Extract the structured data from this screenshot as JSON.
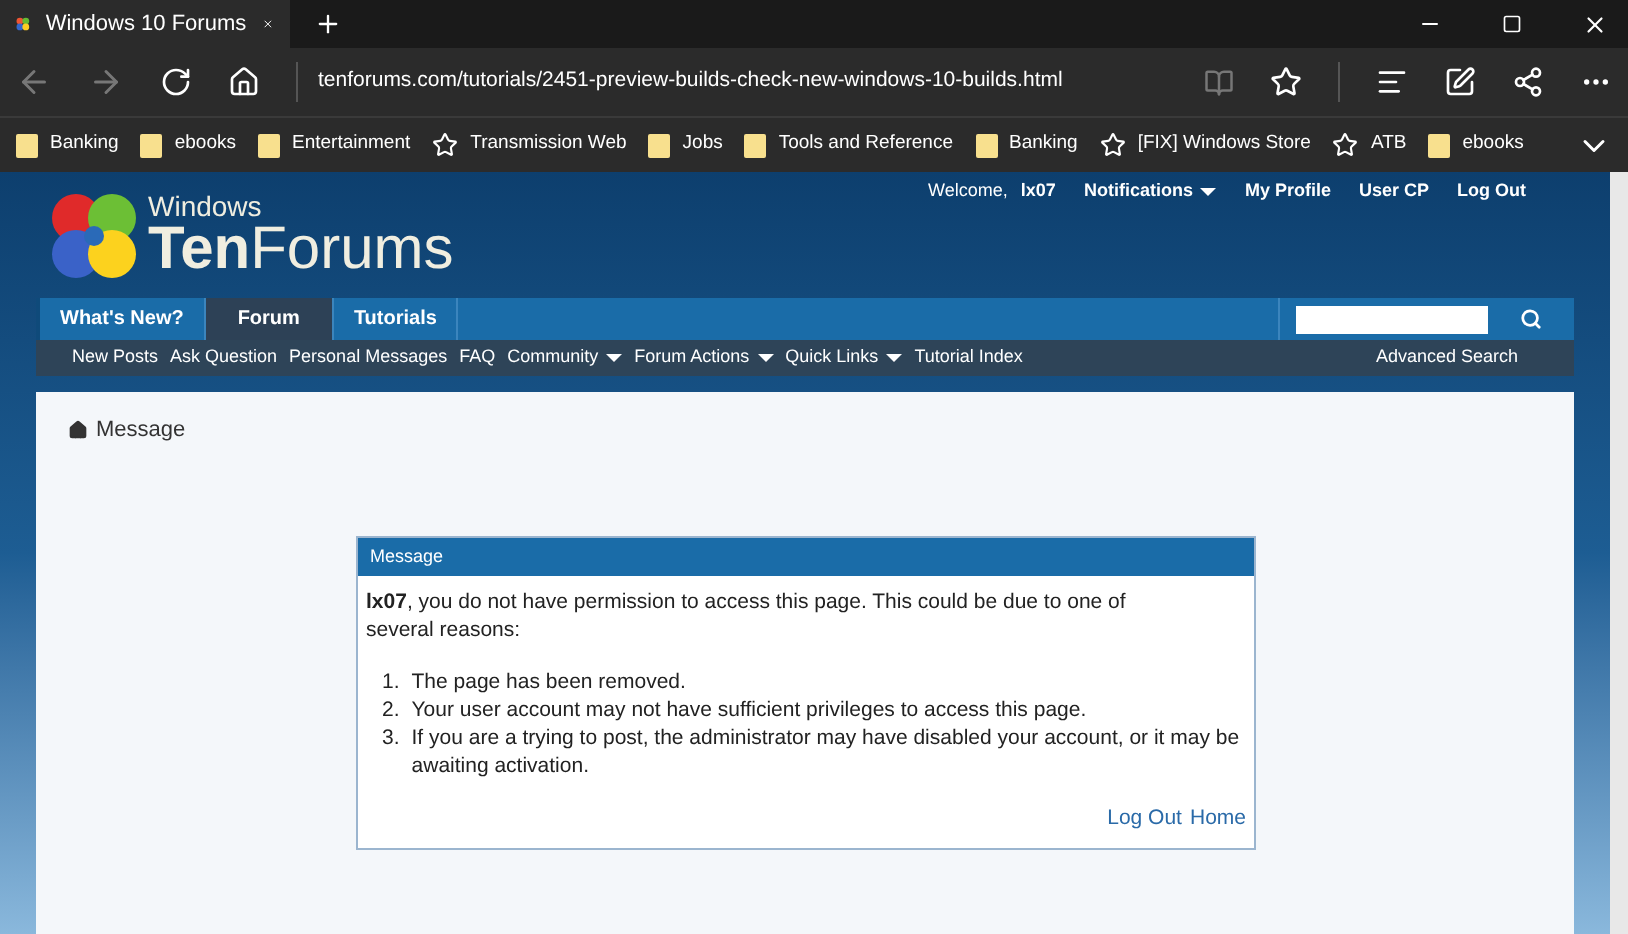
{
  "browser": {
    "tab_title": "Windows 10 Forums",
    "url": "tenforums.com/tutorials/2451-preview-builds-check-new-windows-10-builds.html",
    "bookmarks": [
      {
        "label": "Banking",
        "kind": "folder"
      },
      {
        "label": "ebooks",
        "kind": "folder"
      },
      {
        "label": "Entertainment",
        "kind": "folder"
      },
      {
        "label": "Transmission Web",
        "kind": "star"
      },
      {
        "label": "Jobs",
        "kind": "folder"
      },
      {
        "label": "Tools and Reference",
        "kind": "folder"
      },
      {
        "label": "Banking",
        "kind": "folder"
      },
      {
        "label": "[FIX] Windows Store",
        "kind": "star"
      },
      {
        "label": "ATB",
        "kind": "star"
      },
      {
        "label": "ebooks",
        "kind": "folder"
      }
    ]
  },
  "site": {
    "logo_top": "Windows",
    "logo_main_bold": "Ten",
    "logo_main": "Forums",
    "welcome": "Welcome,",
    "username": "lx07",
    "user_links": [
      {
        "label": "Notifications",
        "has_menu": true
      },
      {
        "label": "My Profile",
        "has_menu": false
      },
      {
        "label": "User CP",
        "has_menu": false
      },
      {
        "label": "Log Out",
        "has_menu": false
      }
    ],
    "tabs": [
      {
        "label": "What's New?",
        "selected": false
      },
      {
        "label": "Forum",
        "selected": true
      },
      {
        "label": "Tutorials",
        "selected": false
      }
    ],
    "subnav": [
      {
        "label": "New Posts",
        "has_menu": false
      },
      {
        "label": "Ask Question",
        "has_menu": false
      },
      {
        "label": "Personal Messages",
        "has_menu": false
      },
      {
        "label": "FAQ",
        "has_menu": false
      },
      {
        "label": "Community",
        "has_menu": true
      },
      {
        "label": "Forum Actions",
        "has_menu": true
      },
      {
        "label": "Quick Links",
        "has_menu": true
      },
      {
        "label": "Tutorial Index",
        "has_menu": false
      }
    ],
    "advanced_search": "Advanced Search"
  },
  "breadcrumb": "Message",
  "message": {
    "title": "Message",
    "intro": "**lx07**, you do not have permission to access this page. This could be due to one of several reasons:",
    "reasons": [
      {
        "number": "1.",
        "text": "The page has been removed."
      },
      {
        "number": "2.",
        "text": "Your user account may not have sufficient privileges to access this page."
      },
      {
        "number": "3.",
        "text": "If you are a trying to post, the administrator may have disabled your account, or it may be awaiting activation."
      }
    ],
    "links": [
      "Log Out",
      "Home"
    ]
  }
}
